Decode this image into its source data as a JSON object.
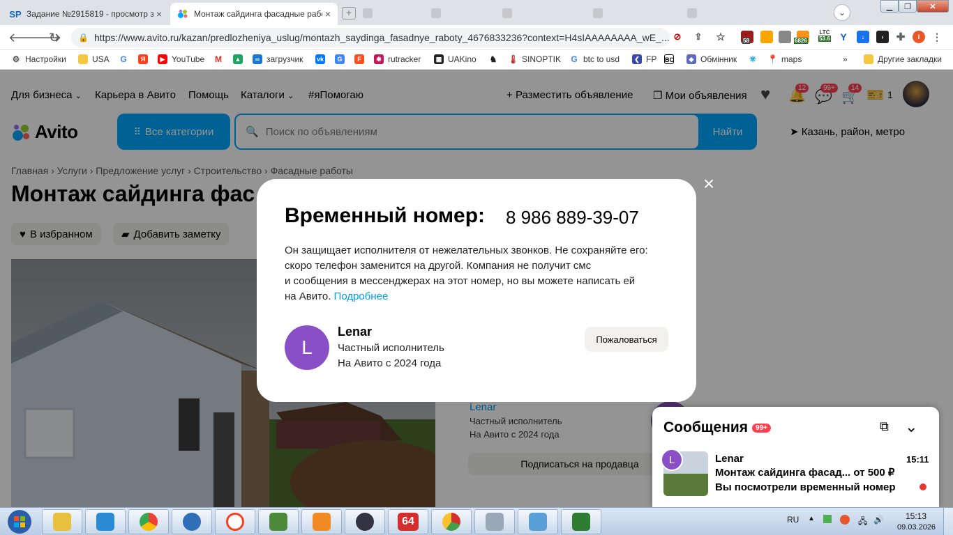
{
  "browser": {
    "tabs": [
      {
        "title": "Задание №2915819 - просмотр з",
        "favicon": "SP",
        "active": false
      },
      {
        "title": "Монтаж сайдинга фасадные рабо",
        "favicon": "avito",
        "active": true
      }
    ],
    "url": "https://www.avito.ru/kazan/predlozheniya_uslug/montazh_saydinga_fasadnye_raboty_4676833236?context=H4sIAAAAAAAA_wE_...",
    "extension_badges": [
      "58",
      "6826",
      "LTC",
      "53.6",
      "I"
    ],
    "bookmarks": [
      "Настройки",
      "USA",
      "YouTube",
      "загрузчик",
      "rutracker",
      "UAKino",
      "SINOPTIK",
      "btc to usd",
      "FP",
      "Обмінник",
      "maps"
    ],
    "other_bookmarks": "Другие закладки",
    "more": "»"
  },
  "site": {
    "topnav": [
      "Для бизнеса",
      "Карьера в Авито",
      "Помощь",
      "Каталоги",
      "#яПомогаю"
    ],
    "post_ad": "Разместить объявление",
    "my_ads": "Мои объявления",
    "badges": {
      "notifications": "12",
      "messages": "99+",
      "cart": "14",
      "favorites_count": "1"
    },
    "logo": "Avito",
    "all_categories": "Все категории",
    "search_placeholder": "Поиск по объявлениям",
    "find": "Найти",
    "location": "Казань, район, метро",
    "breadcrumbs": [
      "Главная",
      "Услуги",
      "Предложение услуг",
      "Строительство",
      "Фасадные работы"
    ],
    "breadcrumb_separator": "›",
    "title": "Монтаж сайдинга фас",
    "in_favorites": "В избранном",
    "add_note": "Добавить заметку",
    "seller": {
      "name": "Lenar",
      "status": "Частный исполнитель",
      "since": "На Авито с 2024 года"
    },
    "subscribe": "Подписаться на продавца"
  },
  "messages_panel": {
    "title": "Сообщения",
    "badge": "99+",
    "chat": {
      "avatar_letter": "L",
      "name": "Lenar",
      "time": "15:11",
      "listing": "Монтаж сайдинга фасад...",
      "price": "от 500 ₽",
      "last_message": "Вы посмотрели временный номер"
    }
  },
  "modal": {
    "title": "Временный номер:",
    "phone": "8 986 889-39-07",
    "text_lines": [
      "Он защищает исполнителя от нежелательных звонков. Не сохраняйте его:",
      "скоро телефон заменится на другой. Компания не получит смс",
      "и сообщения в мессенджерах на этот номер, но вы можете написать ей",
      "на Авито."
    ],
    "more_link": "Подробнее",
    "avatar_letter": "L",
    "name": "Lenar",
    "role": "Частный исполнитель",
    "since": "На Авито с 2024 года",
    "complain": "Пожаловаться"
  },
  "taskbar": {
    "lang": "RU",
    "time": "15:13",
    "date": "09.03.2026",
    "app_64": "64"
  }
}
